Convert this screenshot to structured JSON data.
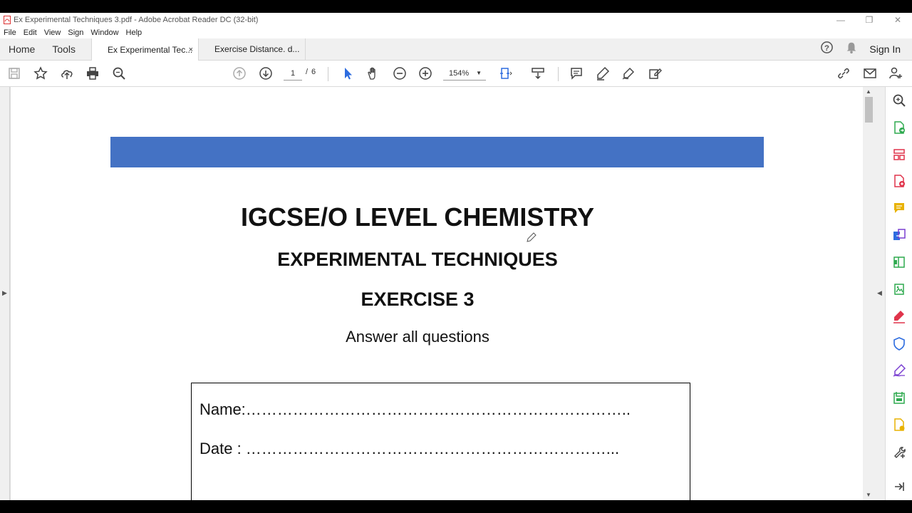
{
  "window": {
    "title": "Ex Experimental Techniques 3.pdf - Adobe Acrobat Reader DC (32-bit)"
  },
  "menu": [
    "File",
    "Edit",
    "View",
    "Sign",
    "Window",
    "Help"
  ],
  "tabs": {
    "home": "Home",
    "tools": "Tools",
    "documents": [
      {
        "label": "Ex Experimental Tec...",
        "active": true,
        "close": "×"
      },
      {
        "label": "Exercise Distance. d...",
        "active": false
      }
    ],
    "sign_in": "Sign In"
  },
  "toolbar": {
    "page_current": "1",
    "page_sep": "/",
    "page_total": "6",
    "zoom": "154%"
  },
  "document": {
    "title": "IGCSE/O LEVEL CHEMISTRY",
    "subtitle": "EXPERIMENTAL TECHNIQUES",
    "exercise": "EXERCISE 3",
    "instruction": "Answer all questions",
    "name_line": "Name:………………………………………………………………..",
    "date_line": "Date : ……………………………………………………………..."
  },
  "colors": {
    "banner": "#4472c4",
    "accent_blue": "#2d6cdf",
    "tool_green": "#2eaa4f",
    "tool_red": "#e0344b",
    "tool_purple": "#7a3fd1",
    "tool_yellow": "#e8b200"
  },
  "icons": {
    "toolbar": [
      "save-icon",
      "bookmark-star-icon",
      "upload-cloud-icon",
      "print-icon",
      "search-icon",
      "page-up-icon",
      "page-down-icon",
      "select-arrow-icon",
      "hand-icon",
      "zoom-out-icon",
      "zoom-in-icon",
      "fit-page-icon",
      "scroll-mode-icon",
      "comment-icon",
      "highlight-pen-icon",
      "draw-icon",
      "fill-sign-icon",
      "share-link-icon",
      "email-icon",
      "add-user-icon"
    ],
    "right_panel": [
      "zoom-tool-icon",
      "export-pdf-icon",
      "organize-pages-icon",
      "create-pdf-icon",
      "comment-tool-icon",
      "combine-files-icon",
      "edit-pdf-icon",
      "export-image-icon",
      "fill-sign-tool-icon",
      "protect-icon",
      "sign-tool-icon",
      "compress-icon",
      "send-review-icon",
      "more-tools-icon",
      "collapse-panel-icon"
    ]
  }
}
